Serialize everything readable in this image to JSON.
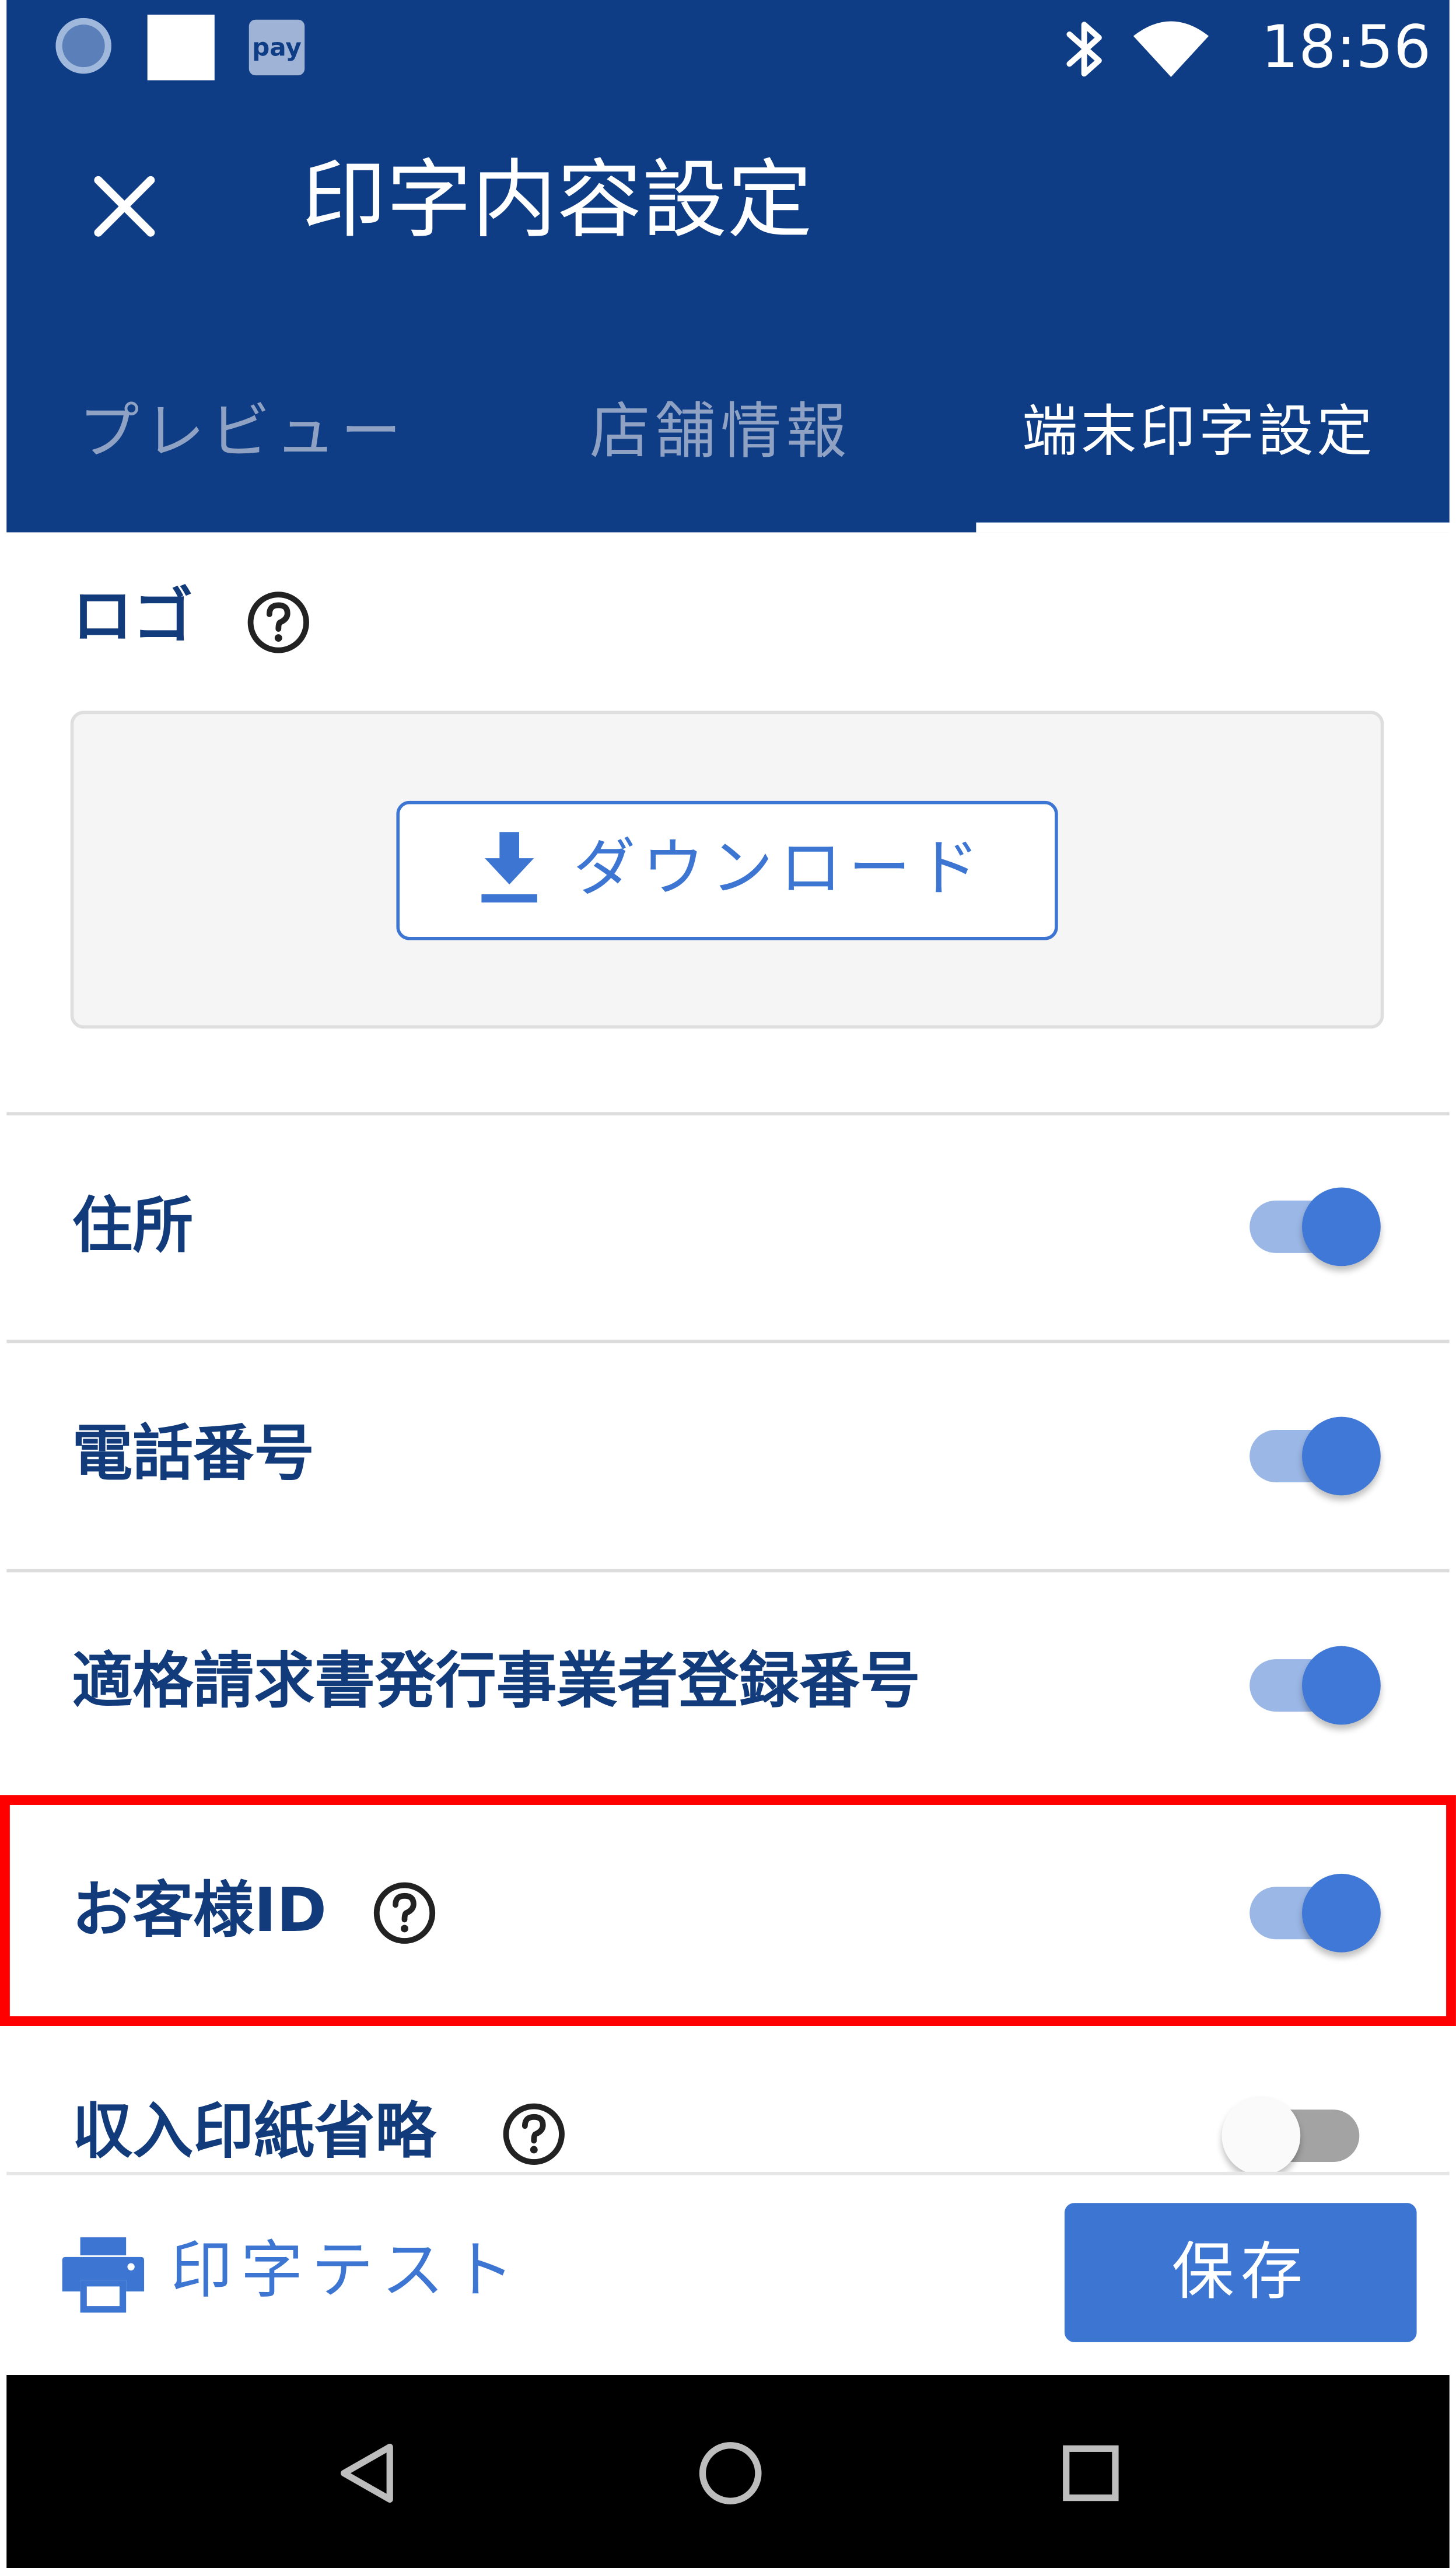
{
  "status_bar": {
    "time": "18:56",
    "pay_icon_label": "pay",
    "icons": [
      "loading-circle-icon",
      "white-square-icon",
      "pay-icon",
      "bluetooth-icon",
      "wifi-icon"
    ]
  },
  "header": {
    "title": "印字内容設定",
    "close_icon": "close-icon"
  },
  "tabs": [
    {
      "label": "プレビュー",
      "selected": false
    },
    {
      "label": "店舗情報",
      "selected": false
    },
    {
      "label": "端末印字設定",
      "selected": true
    }
  ],
  "logo_section": {
    "label": "ロゴ",
    "download_label": "ダウンロード",
    "download_icon": "download-icon"
  },
  "settings": [
    {
      "label": "住所",
      "enabled": true,
      "has_help": false
    },
    {
      "label": "電話番号",
      "enabled": true,
      "has_help": false
    },
    {
      "label": "適格請求書発行事業者登録番号",
      "enabled": true,
      "has_help": false
    },
    {
      "label": "お客様ID",
      "enabled": true,
      "has_help": true,
      "highlighted": true
    },
    {
      "label": "収入印紙省略",
      "enabled": false,
      "has_help": true
    }
  ],
  "footer": {
    "print_test_label": "印字テスト",
    "print_icon": "printer-icon",
    "save_label": "保存"
  },
  "navigation_bar": {
    "icons": [
      "back-triangle-icon",
      "home-circle-icon",
      "recents-square-icon"
    ]
  },
  "colors": {
    "header_bg": "#0e3d85",
    "accent": "#3d75d3",
    "label_text": "#123b7b",
    "highlight_border": "#ff0000",
    "nav_bg": "#000000"
  }
}
